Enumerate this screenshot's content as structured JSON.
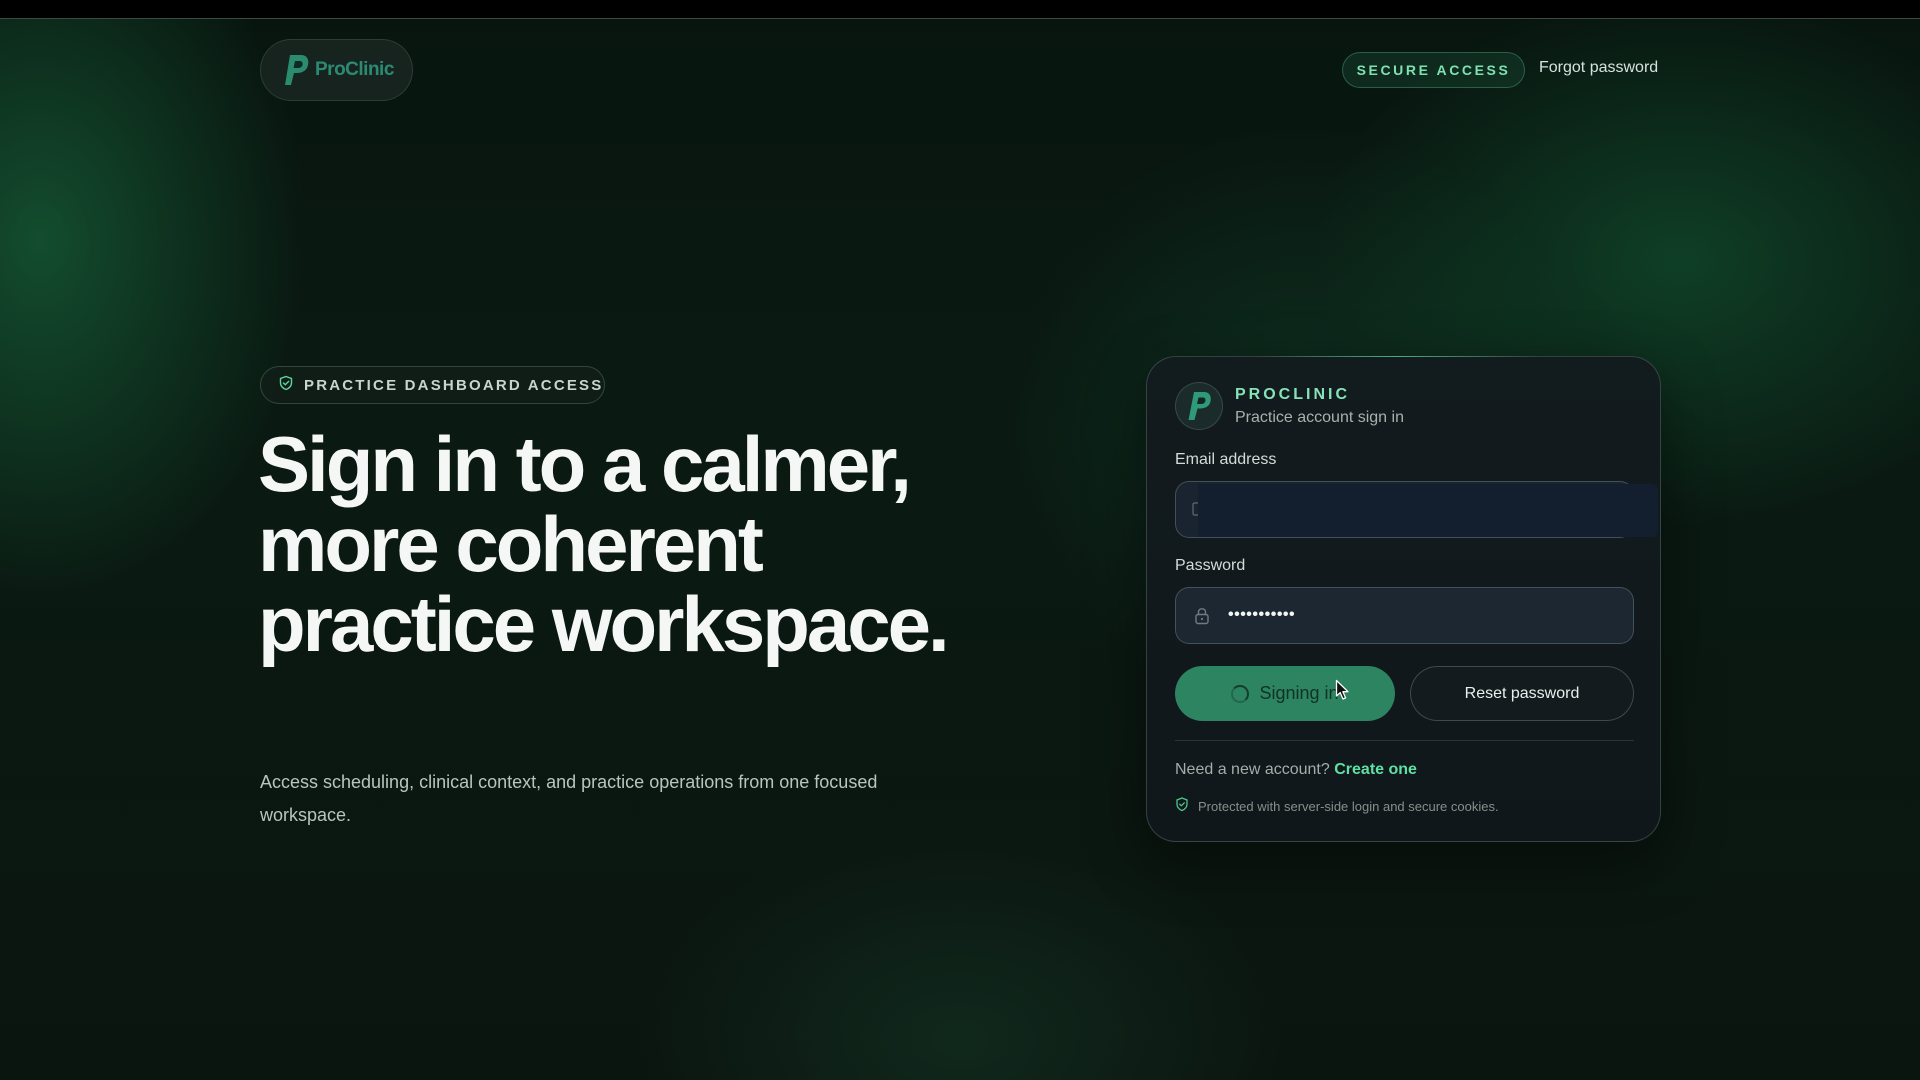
{
  "header": {
    "logo_text": "ProClinic",
    "secure_badge": "SECURE ACCESS",
    "forgot_link": "Forgot password"
  },
  "hero": {
    "eyebrow": "PRACTICE DASHBOARD ACCESS",
    "title": "Sign in to a calmer, more coherent practice workspace.",
    "subtitle": "Access scheduling, clinical context, and practice operations from one focused workspace."
  },
  "card": {
    "brand_name": "PROCLINIC",
    "brand_sub": "Practice account sign in",
    "email_label": "Email address",
    "email_value": "",
    "password_label": "Password",
    "password_value": "•••••••••••",
    "primary_button": "Signing in",
    "secondary_button": "Reset password",
    "signup_prompt": "Need a new account?",
    "signup_link": "Create one",
    "security_note": "Protected with server-side login and secure cookies."
  },
  "colors": {
    "accent": "#2d8461",
    "accent_text": "#5fe0a3",
    "background": "#0a1a12"
  },
  "icons": {
    "logo": "p-logo-icon",
    "eyebrow": "shield-check-icon",
    "email": "mail-icon",
    "password": "lock-icon",
    "button": "spinner-icon",
    "security": "shield-check-icon"
  }
}
